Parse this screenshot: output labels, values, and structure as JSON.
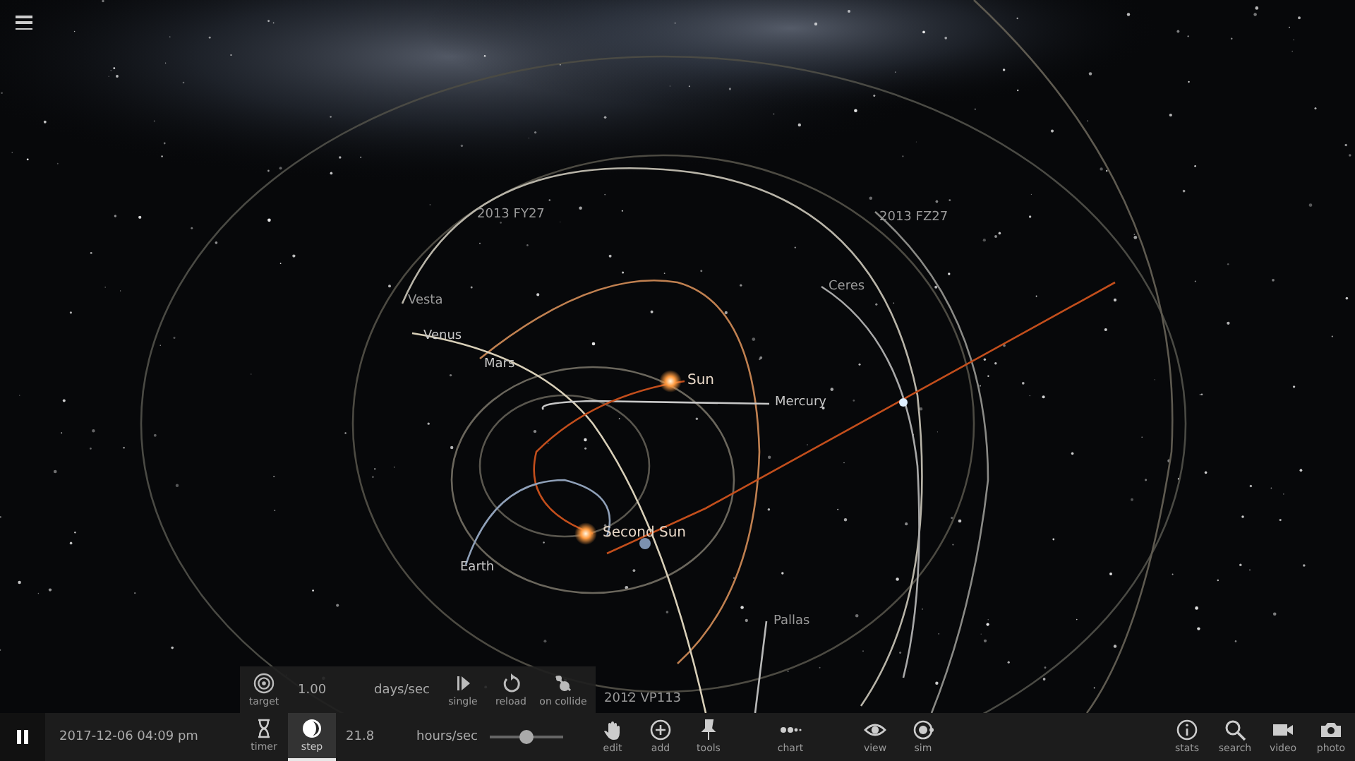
{
  "bodies": [
    {
      "label": "2013 FY27",
      "kind": "minor"
    },
    {
      "label": "2013 FZ27",
      "kind": "minor"
    },
    {
      "label": "Vesta",
      "kind": "minor"
    },
    {
      "label": "Ceres",
      "kind": "minor"
    },
    {
      "label": "Venus",
      "kind": "planet"
    },
    {
      "label": "Mars",
      "kind": "planet"
    },
    {
      "label": "Sun",
      "kind": "star"
    },
    {
      "label": "Mercury",
      "kind": "planet"
    },
    {
      "label": "Second Sun",
      "kind": "star"
    },
    {
      "label": "Earth",
      "kind": "planet"
    },
    {
      "label": "Pallas",
      "kind": "minor"
    },
    {
      "label": "2012 VP113",
      "kind": "minor"
    }
  ],
  "step_panel": {
    "target": "target",
    "speed": "1.00",
    "unit": "days/sec",
    "buttons": [
      "single",
      "reload",
      "on collide"
    ]
  },
  "bottom_bar": {
    "playing": true,
    "date": "2017-12-06 04:09 pm",
    "mode_tabs": [
      {
        "label": "timer",
        "selected": false
      },
      {
        "label": "step",
        "selected": true
      }
    ],
    "speed": "21.8",
    "unit": "hours/sec",
    "speed_slider": {
      "level": 0.5
    },
    "tools": [
      "edit",
      "add",
      "tools",
      "chart",
      "view",
      "sim"
    ],
    "right_tools": [
      "stats",
      "search",
      "video",
      "photo"
    ]
  }
}
